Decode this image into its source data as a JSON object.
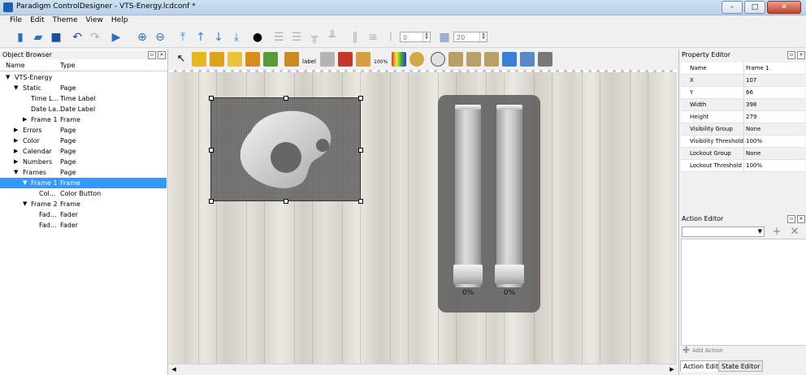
{
  "window": {
    "title": "Paradigm ControlDesigner - VTS-Energy.lcdconf *",
    "btn_min": "–",
    "btn_max": "□",
    "btn_close": "✕"
  },
  "menu": [
    "File",
    "Edit",
    "Theme",
    "View",
    "Help"
  ],
  "toolbar": {
    "spin_value_1": "0",
    "spin_value_2": "20"
  },
  "object_browser": {
    "title": "Object Browser",
    "col_name": "Name",
    "col_type": "Type",
    "rows": [
      {
        "name": "VTS-Energy",
        "type": ""
      },
      {
        "name": "Static",
        "type": "Page"
      },
      {
        "name": "Time L...",
        "type": "Time Label"
      },
      {
        "name": "Date La...",
        "type": "Date Label"
      },
      {
        "name": "Frame 1",
        "type": "Frame"
      },
      {
        "name": "Errors",
        "type": "Page"
      },
      {
        "name": "Color",
        "type": "Page"
      },
      {
        "name": "Calendar",
        "type": "Page"
      },
      {
        "name": "Numbers",
        "type": "Page"
      },
      {
        "name": "Frames",
        "type": "Page"
      },
      {
        "name": "Frame 1",
        "type": "Frame"
      },
      {
        "name": "Col...",
        "type": "Color Button"
      },
      {
        "name": "Frame 2",
        "type": "Frame"
      },
      {
        "name": "Fad...",
        "type": "Fader"
      },
      {
        "name": "Fad...",
        "type": "Fader"
      }
    ]
  },
  "canvas": {
    "fader1_value": "0%",
    "fader2_value": "0%"
  },
  "property_editor": {
    "title": "Property Editor",
    "rows": [
      {
        "name": "Name",
        "value": "Frame 1"
      },
      {
        "name": "X",
        "value": "107"
      },
      {
        "name": "Y",
        "value": "66"
      },
      {
        "name": "Width",
        "value": "398"
      },
      {
        "name": "Height",
        "value": "279"
      },
      {
        "name": "Visibility Group",
        "value": "None"
      },
      {
        "name": "Visibility Threshold",
        "value": "100%"
      },
      {
        "name": "Lockout Group",
        "value": "None"
      },
      {
        "name": "Lockout Threshold",
        "value": "100%"
      }
    ]
  },
  "action_editor": {
    "title": "Action Editor",
    "add_action": "Add Action",
    "add_icon": "+",
    "delete_icon": "✕"
  },
  "tabs": {
    "action_editor": "Action Editor",
    "state_editor": "State Editor"
  }
}
